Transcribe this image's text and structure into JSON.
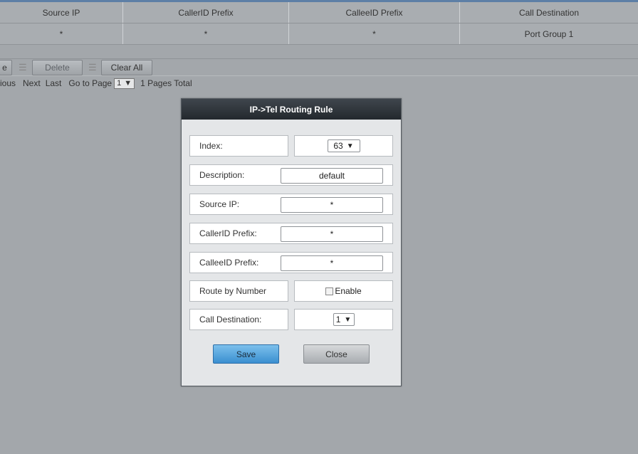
{
  "table": {
    "headers": [
      "Source IP",
      "CallerID Prefix",
      "CalleeID Prefix",
      "Call Destination"
    ],
    "row": [
      "*",
      "*",
      "*",
      "Port Group 1"
    ]
  },
  "toolbar": {
    "partial_button": "e",
    "delete_label": "Delete",
    "separator": "☰",
    "clear_all_label": "Clear All"
  },
  "pager": {
    "previous_partial": "ious",
    "next_label": "Next",
    "last_label": "Last",
    "goto_label": "Go to Page",
    "page_value": "1",
    "total_label": "1 Pages Total"
  },
  "dialog": {
    "title": "IP->Tel Routing Rule",
    "index_label": "Index:",
    "index_value": "63",
    "description_label": "Description:",
    "description_value": "default",
    "source_ip_label": "Source IP:",
    "source_ip_value": "*",
    "callerid_label": "CallerID Prefix:",
    "callerid_value": "*",
    "calleeid_label": "CalleeID Prefix:",
    "calleeid_value": "*",
    "route_by_number_label": "Route by Number",
    "enable_label": "Enable",
    "enable_checked": false,
    "call_destination_label": "Call Destination:",
    "call_destination_value": "1",
    "save_label": "Save",
    "close_label": "Close"
  },
  "icons": {
    "dropdown": "triangle-down-icon"
  },
  "colors": {
    "overlay": "#a3a7ab",
    "title_bar": "#2e3439",
    "save_button": "#4a9ad8"
  }
}
